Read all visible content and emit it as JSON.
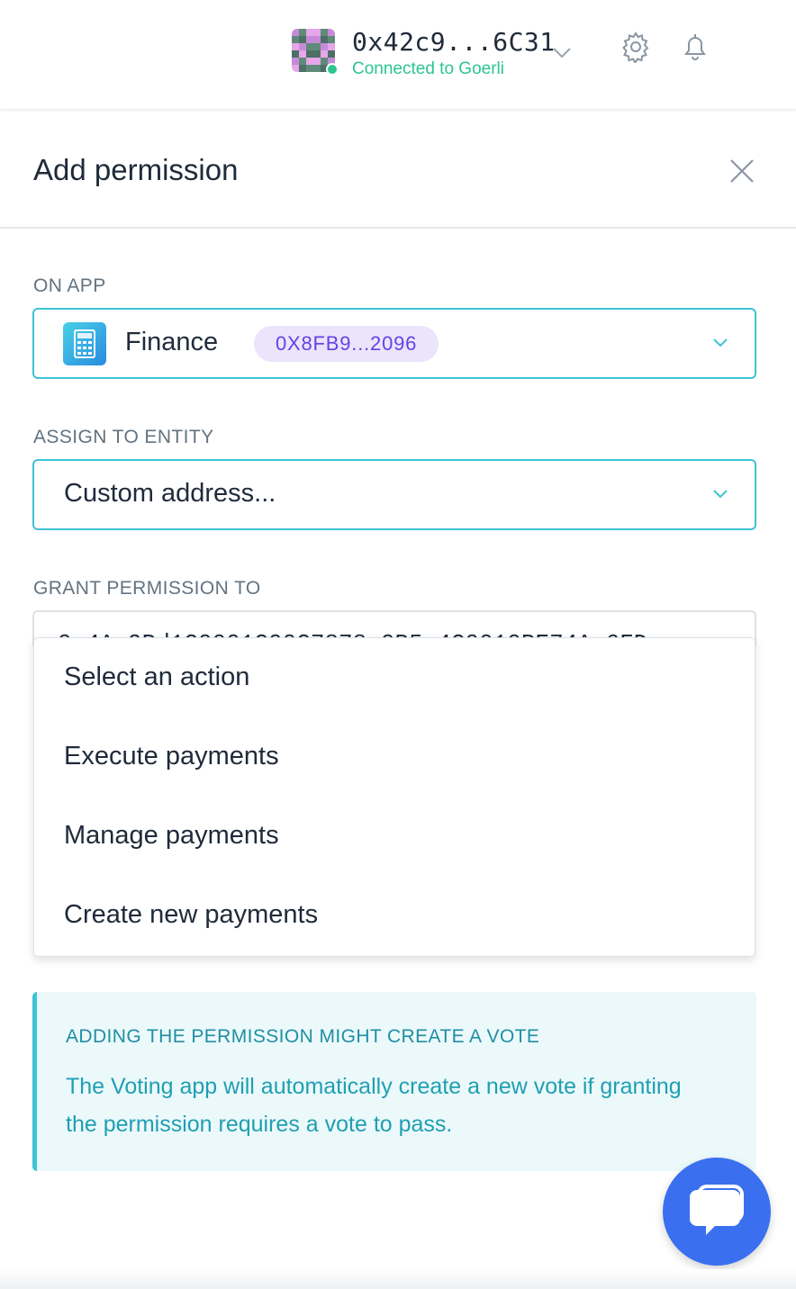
{
  "account": {
    "address": "0x42c9...6C31",
    "network_status": "Connected to Goerli"
  },
  "panel": {
    "title": "Add permission"
  },
  "on_app": {
    "label": "ON APP",
    "app_name": "Finance",
    "app_address": "0X8FB9...2096"
  },
  "assign_to_entity": {
    "label": "ASSIGN TO ENTITY",
    "value": "Custom address..."
  },
  "grant_permission_to": {
    "label": "GRANT PERMISSION TO",
    "partial_value": "0x4Ac9Bd1C0001C00C7878c0B5e4C0010BE74Ac6FD"
  },
  "action_dropdown": {
    "options": [
      "Select an action",
      "Execute payments",
      "Manage payments",
      "Create new payments"
    ]
  },
  "info": {
    "title": "ADDING THE PERMISSION MIGHT CREATE A VOTE",
    "text": "The Voting app will automatically create a new vote if granting the permission requires a vote to pass."
  },
  "colors": {
    "accent": "#3ec3d6",
    "badge_bg": "#ebe4fb",
    "badge_text": "#6442e6",
    "online": "#2cc68f",
    "chat": "#3a70f0"
  },
  "icons": [
    "identicon",
    "chevron-down-icon",
    "gear-icon",
    "bell-icon",
    "close-icon",
    "calculator-icon",
    "chat-icon"
  ]
}
